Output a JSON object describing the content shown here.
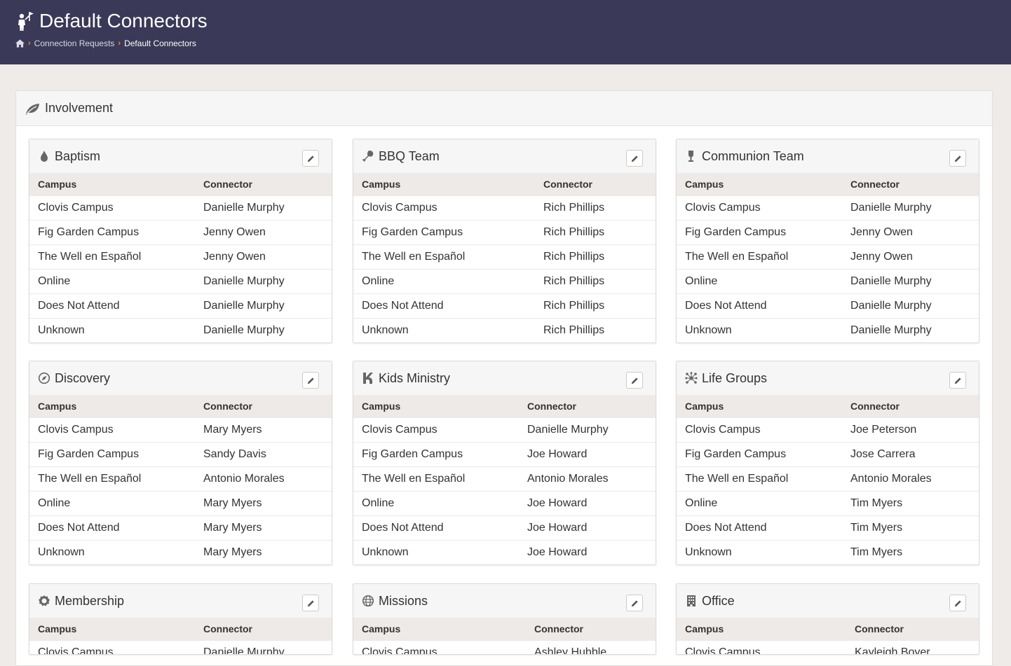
{
  "header": {
    "title": "Default Connectors",
    "icon": "person-flag-icon",
    "breadcrumbs": [
      {
        "label": "Connection Requests"
      },
      {
        "label": "Default Connectors"
      }
    ]
  },
  "section": {
    "title": "Involvement",
    "icon": "leaf-icon"
  },
  "columns": {
    "campus": "Campus",
    "connector": "Connector"
  },
  "colors": {
    "header_bg": "#3a3957",
    "breadcrumb_sep": "#f28c28",
    "page_bg": "#efebe8"
  },
  "cards": [
    {
      "title": "Baptism",
      "icon": "water-drop-icon",
      "rows": [
        {
          "campus": "Clovis Campus",
          "connector": "Danielle Murphy"
        },
        {
          "campus": "Fig Garden Campus",
          "connector": "Jenny Owen"
        },
        {
          "campus": "The Well en Español",
          "connector": "Jenny Owen"
        },
        {
          "campus": "Online",
          "connector": "Danielle Murphy"
        },
        {
          "campus": "Does Not Attend",
          "connector": "Danielle Murphy"
        },
        {
          "campus": "Unknown",
          "connector": "Danielle Murphy"
        }
      ]
    },
    {
      "title": "BBQ Team",
      "icon": "meat-leg-icon",
      "rows": [
        {
          "campus": "Clovis Campus",
          "connector": "Rich Phillips"
        },
        {
          "campus": "Fig Garden Campus",
          "connector": "Rich Phillips"
        },
        {
          "campus": "The Well en Español",
          "connector": "Rich Phillips"
        },
        {
          "campus": "Online",
          "connector": "Rich Phillips"
        },
        {
          "campus": "Does Not Attend",
          "connector": "Rich Phillips"
        },
        {
          "campus": "Unknown",
          "connector": "Rich Phillips"
        }
      ]
    },
    {
      "title": "Communion Team",
      "icon": "wine-glass-icon",
      "rows": [
        {
          "campus": "Clovis Campus",
          "connector": "Danielle Murphy"
        },
        {
          "campus": "Fig Garden Campus",
          "connector": "Jenny Owen"
        },
        {
          "campus": "The Well en Español",
          "connector": "Jenny Owen"
        },
        {
          "campus": "Online",
          "connector": "Danielle Murphy"
        },
        {
          "campus": "Does Not Attend",
          "connector": "Danielle Murphy"
        },
        {
          "campus": "Unknown",
          "connector": "Danielle Murphy"
        }
      ]
    },
    {
      "title": "Discovery",
      "icon": "compass-icon",
      "rows": [
        {
          "campus": "Clovis Campus",
          "connector": "Mary Myers"
        },
        {
          "campus": "Fig Garden Campus",
          "connector": "Sandy Davis"
        },
        {
          "campus": "The Well en Español",
          "connector": "Antonio Morales"
        },
        {
          "campus": "Online",
          "connector": "Mary Myers"
        },
        {
          "campus": "Does Not Attend",
          "connector": "Mary Myers"
        },
        {
          "campus": "Unknown",
          "connector": "Mary Myers"
        }
      ]
    },
    {
      "title": "Kids Ministry",
      "icon": "kid-icon",
      "rows": [
        {
          "campus": "Clovis Campus",
          "connector": "Danielle Murphy"
        },
        {
          "campus": "Fig Garden Campus",
          "connector": "Joe Howard"
        },
        {
          "campus": "The Well en Español",
          "connector": "Antonio Morales"
        },
        {
          "campus": "Online",
          "connector": "Joe Howard"
        },
        {
          "campus": "Does Not Attend",
          "connector": "Joe Howard"
        },
        {
          "campus": "Unknown",
          "connector": "Joe Howard"
        }
      ]
    },
    {
      "title": "Life Groups",
      "icon": "network-icon",
      "rows": [
        {
          "campus": "Clovis Campus",
          "connector": "Joe Peterson"
        },
        {
          "campus": "Fig Garden Campus",
          "connector": "Jose Carrera"
        },
        {
          "campus": "The Well en Español",
          "connector": "Antonio Morales"
        },
        {
          "campus": "Online",
          "connector": "Tim Myers"
        },
        {
          "campus": "Does Not Attend",
          "connector": "Tim Myers"
        },
        {
          "campus": "Unknown",
          "connector": "Tim Myers"
        }
      ]
    },
    {
      "title": "Membership",
      "icon": "badge-seal-icon",
      "rows": [
        {
          "campus": "Clovis Campus",
          "connector": "Danielle Murphy"
        }
      ]
    },
    {
      "title": "Missions",
      "icon": "globe-icon",
      "rows": [
        {
          "campus": "Clovis Campus",
          "connector": "Ashley Hubble"
        }
      ]
    },
    {
      "title": "Office",
      "icon": "building-icon",
      "rows": [
        {
          "campus": "Clovis Campus",
          "connector": "Kayleigh Boyer"
        }
      ]
    }
  ]
}
